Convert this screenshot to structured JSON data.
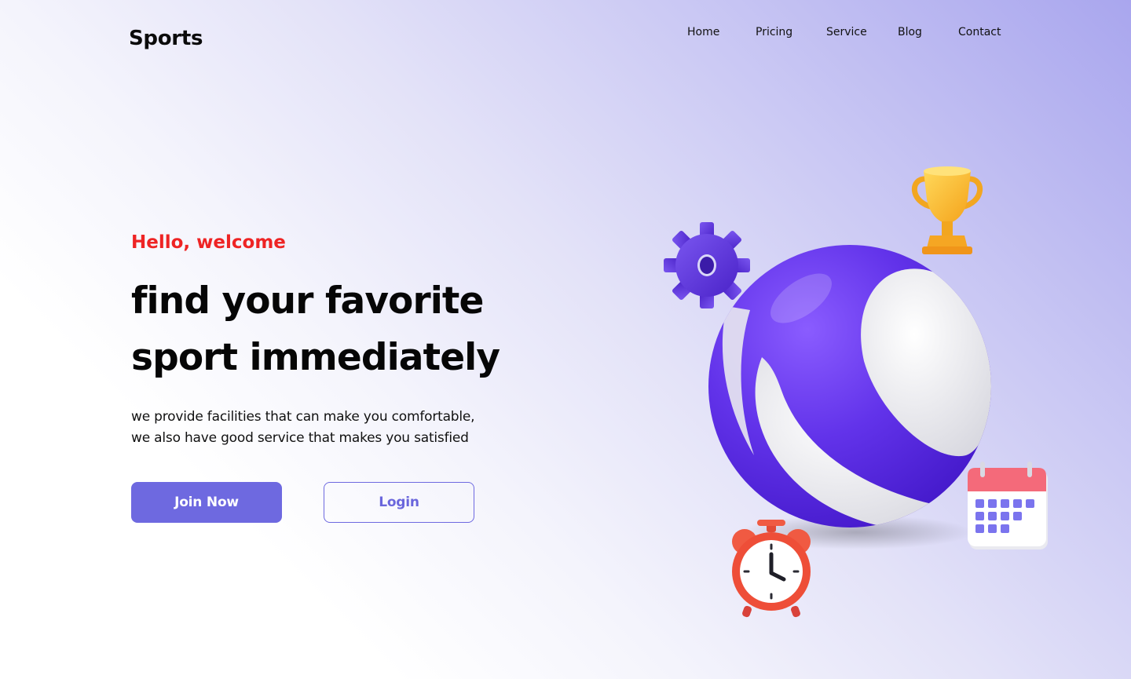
{
  "brand": {
    "name": "Sports"
  },
  "nav": {
    "items": [
      "Home",
      "Pricing",
      "Service",
      "Blog",
      "Contact"
    ]
  },
  "hero": {
    "greeting": "Hello, welcome",
    "headline_line1": "find your favorite",
    "headline_line2": "sport immediately",
    "description_line1": "we provide facilities that can make you comfortable,",
    "description_line2": "we also have good service that makes you satisfied",
    "join_button_label": "Join Now",
    "login_button_label": "Login"
  },
  "illustration": {
    "icons": [
      "gear-icon",
      "trophy-icon",
      "ball-icon",
      "calendar-icon",
      "alarm-clock-icon"
    ]
  },
  "colors": {
    "accent": "#6e69e0",
    "greeting": "#ee2424",
    "ball": "#5b2ee0"
  }
}
